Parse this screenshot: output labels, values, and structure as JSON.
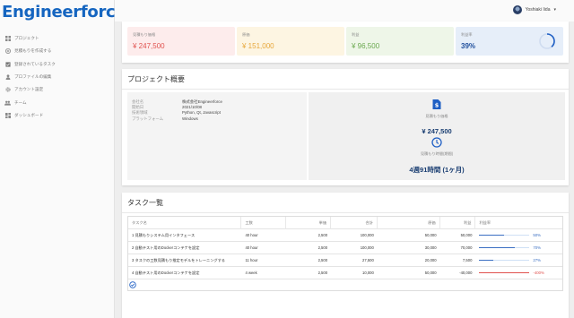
{
  "brand": {
    "name": "Engineerforce"
  },
  "sidebar": {
    "items": [
      {
        "label": "プロジェクト",
        "icon": "grid-icon"
      },
      {
        "label": "見積もりを作成する",
        "icon": "plus-circle-icon"
      },
      {
        "label": "登録されているタスク",
        "icon": "checkbox-icon"
      },
      {
        "label": "プロファイルの編集",
        "icon": "person-icon"
      },
      {
        "label": "アカウント設定",
        "icon": "gear-icon"
      },
      {
        "label": "チーム",
        "icon": "group-icon"
      },
      {
        "label": "ダッシュボード",
        "icon": "dashboard-icon"
      }
    ]
  },
  "topbar": {
    "user_name": "Yoshiaki Iida",
    "caret": "▾"
  },
  "summary": {
    "estimate": {
      "label": "見積もり価格",
      "value": "¥ 247,500",
      "color": "#e0524f",
      "bg": "#fdecec"
    },
    "cost": {
      "label": "原価",
      "value": "¥ 151,000",
      "color": "#e7a73a",
      "bg": "#fdf5e2"
    },
    "profit": {
      "label": "利益",
      "value": "¥ 96,500",
      "color": "#6aa84f",
      "bg": "#eef6e8"
    },
    "margin": {
      "label": "利益率",
      "value": "39%",
      "color": "#1f4e9c",
      "bg": "#e6eef9",
      "ratio": 0.39
    }
  },
  "overview": {
    "title": "プロジェクト概要",
    "rows": [
      {
        "key": "会社名",
        "value": "株式会社Engineerforce"
      },
      {
        "key": "開始日",
        "value": "2021/10/08"
      },
      {
        "key": "技術領域",
        "value": "Python, Qt, Javascript"
      },
      {
        "key": "プラットフォーム",
        "value": "Windows"
      }
    ],
    "estimate_label": "見積もり価格",
    "estimate_value": "¥ 247,500",
    "duration_label": "見積もり時間(期間)",
    "duration_value": "4週91時間 (1ヶ月)"
  },
  "tasks": {
    "title": "タスク一覧",
    "headers": [
      "タスク名",
      "工数",
      "単価",
      "合計",
      "原価",
      "利益",
      "利益率"
    ],
    "rows": [
      {
        "name": "1  見積もりシステム用インタフェース",
        "effort": "40 hour",
        "unit": "2,500",
        "total": "100,000",
        "cost": "50,000",
        "profit": "50,000",
        "rate": "50%",
        "ratio": 0.5,
        "color": "#3b6fc2"
      },
      {
        "name": "2  自動テスト用のDockerコンテナを設定",
        "effort": "40 hour",
        "unit": "2,500",
        "total": "100,000",
        "cost": "30,000",
        "profit": "70,000",
        "rate": "70%",
        "ratio": 0.7,
        "color": "#3b6fc2"
      },
      {
        "name": "3  タスクの工数見積もり推定モデルをトレーニングする",
        "effort": "11 hour",
        "unit": "2,500",
        "total": "27,500",
        "cost": "20,000",
        "profit": "7,500",
        "rate": "27%",
        "ratio": 0.27,
        "color": "#3b6fc2"
      },
      {
        "name": "4  自動テスト用のDockerコンテナを設定",
        "effort": "4 week",
        "unit": "2,500",
        "total": "10,000",
        "cost": "50,000",
        "profit": "-40,000",
        "rate": "-400%",
        "ratio": 1.0,
        "color": "#e0524f"
      }
    ]
  }
}
